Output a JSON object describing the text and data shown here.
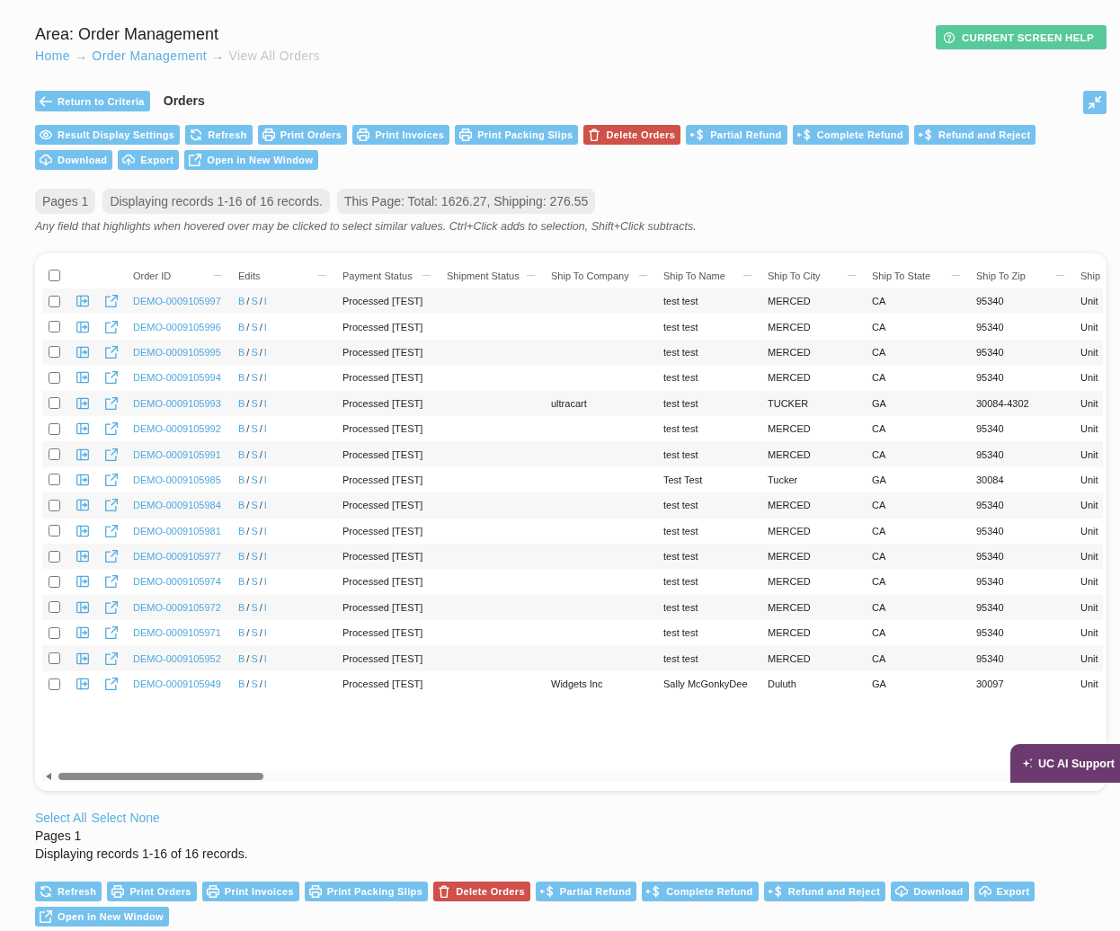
{
  "header": {
    "title": "Area: Order Management",
    "breadcrumb": [
      {
        "label": "Home",
        "kind": "link"
      },
      {
        "label": "→",
        "kind": "separator"
      },
      {
        "label": "Order Management",
        "kind": "link"
      },
      {
        "label": "→",
        "kind": "separator"
      },
      {
        "label": "View All Orders",
        "kind": "current"
      }
    ],
    "help_button": "CURRENT SCREEN HELP"
  },
  "results": {
    "back_button": "Return to Criteria",
    "heading": "Orders"
  },
  "toolbar": [
    {
      "label": "Result Display Settings",
      "kind": "display"
    },
    {
      "label": "Refresh",
      "kind": "refresh"
    },
    {
      "label": "Print Orders",
      "kind": "print"
    },
    {
      "label": "Print Invoices",
      "kind": "print"
    },
    {
      "label": "Print Packing Slips",
      "kind": "print"
    },
    {
      "label": "Delete Orders",
      "kind": "delete"
    },
    {
      "label": "Partial Refund",
      "kind": "refund"
    },
    {
      "label": "Complete Refund",
      "kind": "refund"
    },
    {
      "label": "Refund and Reject",
      "kind": "refund"
    },
    {
      "label": "Download",
      "kind": "download"
    },
    {
      "label": "Export",
      "kind": "export"
    },
    {
      "label": "Open in New Window",
      "kind": "window"
    }
  ],
  "summary": [
    "Pages 1",
    "Displaying records 1-16 of 16 records.",
    "This Page: Total: 1626.27, Shipping: 276.55"
  ],
  "hint": "Any field that highlights when hovered over may be clicked to select similar values. Ctrl+Click adds to selection, Shift+Click subtracts.",
  "table": {
    "select_all": {
      "checked": false
    },
    "columns": [
      "Order ID",
      "Edits",
      "Payment Status",
      "Shipment Status",
      "Ship To Company",
      "Ship To Name",
      "Ship To City",
      "Ship To State",
      "Ship To Zip",
      "Ship"
    ],
    "rows": [
      {
        "checked": false,
        "order_id": "DEMO-0009105997",
        "edits": [
          "B",
          "/",
          "S",
          "/",
          "I"
        ],
        "payment_status": "Processed [TEST]",
        "ship_to_name": "test test",
        "ship_to_city": "MERCED",
        "ship_to_state": "CA",
        "ship_to_zip": "95340",
        "column_10": "Unit"
      },
      {
        "checked": false,
        "order_id": "DEMO-0009105996",
        "edits": [
          "B",
          "/",
          "S",
          "/",
          "I"
        ],
        "payment_status": "Processed [TEST]",
        "ship_to_name": "test test",
        "ship_to_city": "MERCED",
        "ship_to_state": "CA",
        "ship_to_zip": "95340",
        "column_10": "Unit"
      },
      {
        "checked": false,
        "order_id": "DEMO-0009105995",
        "edits": [
          "B",
          "/",
          "S",
          "/",
          "I"
        ],
        "payment_status": "Processed [TEST]",
        "ship_to_name": "test test",
        "ship_to_city": "MERCED",
        "ship_to_state": "CA",
        "ship_to_zip": "95340",
        "column_10": "Unit"
      },
      {
        "checked": false,
        "order_id": "DEMO-0009105994",
        "edits": [
          "B",
          "/",
          "S",
          "/",
          "I"
        ],
        "payment_status": "Processed [TEST]",
        "ship_to_name": "test test",
        "ship_to_city": "MERCED",
        "ship_to_state": "CA",
        "ship_to_zip": "95340",
        "column_10": "Unit"
      },
      {
        "checked": false,
        "order_id": "DEMO-0009105993",
        "edits": [
          "B",
          "/",
          "S",
          "/",
          "I"
        ],
        "payment_status": "Processed [TEST]",
        "ship_to_company": "ultracart",
        "ship_to_name": "test test",
        "ship_to_city": "TUCKER",
        "ship_to_state": "GA",
        "ship_to_zip": "30084-4302",
        "column_10": "Unit"
      },
      {
        "checked": false,
        "order_id": "DEMO-0009105992",
        "edits": [
          "B",
          "/",
          "S",
          "/",
          "I"
        ],
        "payment_status": "Processed [TEST]",
        "ship_to_name": "test test",
        "ship_to_city": "MERCED",
        "ship_to_state": "CA",
        "ship_to_zip": "95340",
        "column_10": "Unit"
      },
      {
        "checked": false,
        "order_id": "DEMO-0009105991",
        "edits": [
          "B",
          "/",
          "S",
          "/",
          "I"
        ],
        "payment_status": "Processed [TEST]",
        "ship_to_name": "test test",
        "ship_to_city": "MERCED",
        "ship_to_state": "CA",
        "ship_to_zip": "95340",
        "column_10": "Unit"
      },
      {
        "checked": false,
        "order_id": "DEMO-0009105985",
        "edits": [
          "B",
          "/",
          "S",
          "/",
          "I"
        ],
        "payment_status": "Processed [TEST]",
        "ship_to_name": "Test Test",
        "ship_to_city": "Tucker",
        "ship_to_state": "GA",
        "ship_to_zip": "30084",
        "column_10": "Unit"
      },
      {
        "checked": false,
        "order_id": "DEMO-0009105984",
        "edits": [
          "B",
          "/",
          "S",
          "/",
          "I"
        ],
        "payment_status": "Processed [TEST]",
        "ship_to_name": "test test",
        "ship_to_city": "MERCED",
        "ship_to_state": "CA",
        "ship_to_zip": "95340",
        "column_10": "Unit"
      },
      {
        "checked": false,
        "order_id": "DEMO-0009105981",
        "edits": [
          "B",
          "/",
          "S",
          "/",
          "I"
        ],
        "payment_status": "Processed [TEST]",
        "ship_to_name": "test test",
        "ship_to_city": "MERCED",
        "ship_to_state": "CA",
        "ship_to_zip": "95340",
        "column_10": "Unit"
      },
      {
        "checked": false,
        "order_id": "DEMO-0009105977",
        "edits": [
          "B",
          "/",
          "S",
          "/",
          "I"
        ],
        "payment_status": "Processed [TEST]",
        "ship_to_name": "test test",
        "ship_to_city": "MERCED",
        "ship_to_state": "CA",
        "ship_to_zip": "95340",
        "column_10": "Unit"
      },
      {
        "checked": false,
        "order_id": "DEMO-0009105974",
        "edits": [
          "B",
          "/",
          "S",
          "/",
          "I"
        ],
        "payment_status": "Processed [TEST]",
        "ship_to_name": "test test",
        "ship_to_city": "MERCED",
        "ship_to_state": "CA",
        "ship_to_zip": "95340",
        "column_10": "Unit"
      },
      {
        "checked": false,
        "order_id": "DEMO-0009105972",
        "edits": [
          "B",
          "/",
          "S",
          "/",
          "I"
        ],
        "payment_status": "Processed [TEST]",
        "ship_to_name": "test test",
        "ship_to_city": "MERCED",
        "ship_to_state": "CA",
        "ship_to_zip": "95340",
        "column_10": "Unit"
      },
      {
        "checked": false,
        "order_id": "DEMO-0009105971",
        "edits": [
          "B",
          "/",
          "S",
          "/",
          "I"
        ],
        "payment_status": "Processed [TEST]",
        "ship_to_name": "test test",
        "ship_to_city": "MERCED",
        "ship_to_state": "CA",
        "ship_to_zip": "95340",
        "column_10": "Unit"
      },
      {
        "checked": false,
        "order_id": "DEMO-0009105952",
        "edits": [
          "B",
          "/",
          "S",
          "/",
          "I"
        ],
        "payment_status": "Processed [TEST]",
        "ship_to_name": "test test",
        "ship_to_city": "MERCED",
        "ship_to_state": "CA",
        "ship_to_zip": "95340",
        "column_10": "Unit"
      },
      {
        "checked": false,
        "order_id": "DEMO-0009105949",
        "edits": [
          "B",
          "/",
          "S",
          "/",
          "I"
        ],
        "payment_status": "Processed [TEST]",
        "ship_to_company": "Widgets Inc",
        "ship_to_name": "Sally McGonkyDee",
        "ship_to_city": "Duluth",
        "ship_to_state": "GA",
        "ship_to_zip": "30097",
        "column_10": "Unit"
      }
    ]
  },
  "support_button": "UC AI Support",
  "footer": {
    "select_links": [
      "Select All",
      "Select None"
    ],
    "pages": "Pages 1",
    "records": "Displaying records 1-16 of 16 records.",
    "toolbar": [
      {
        "label": "Refresh",
        "kind": "refresh"
      },
      {
        "label": "Print Orders",
        "kind": "print"
      },
      {
        "label": "Print Invoices",
        "kind": "print"
      },
      {
        "label": "Print Packing Slips",
        "kind": "print"
      },
      {
        "label": "Delete Orders",
        "kind": "delete"
      },
      {
        "label": "Partial Refund",
        "kind": "refund"
      },
      {
        "label": "Complete Refund",
        "kind": "refund"
      },
      {
        "label": "Refund and Reject",
        "kind": "refund"
      },
      {
        "label": "Download",
        "kind": "download"
      },
      {
        "label": "Export",
        "kind": "export"
      },
      {
        "label": "Open in New Window",
        "kind": "window"
      }
    ]
  }
}
